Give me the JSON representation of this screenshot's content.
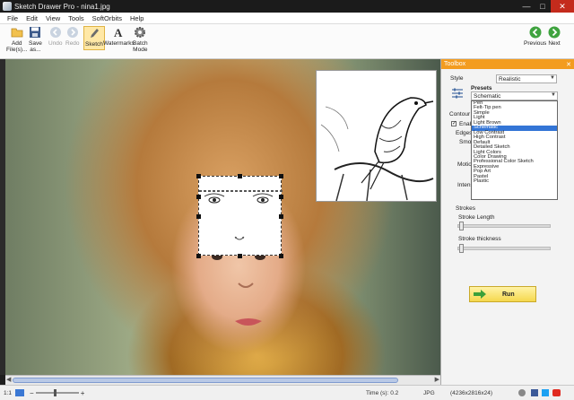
{
  "window": {
    "title": "Sketch Drawer Pro - nina1.jpg"
  },
  "menu": [
    "File",
    "Edit",
    "View",
    "Tools",
    "SoftOrbits",
    "Help"
  ],
  "ribbon": {
    "add_files": "Add\nFile(s)...",
    "save_as": "Save\nas...",
    "undo": "Undo",
    "redo": "Redo",
    "sketch": "Sketch",
    "watermarks": "Watermarks",
    "batch_mode": "Batch\nMode",
    "previous": "Previous",
    "next": "Next"
  },
  "toolbox": {
    "header": "Toolbox",
    "style_label": "Style",
    "style_value": "Realistic",
    "presets_label": "Presets",
    "presets_value": "Schematic",
    "presets": [
      "Pen",
      "Felt-Tip pen",
      "Simple",
      "Light",
      "Light Brown",
      "Schematic",
      "Low Contrast",
      "High Contrast",
      "Default",
      "Detailed Sketch",
      "Light Colors",
      "Color Drawing",
      "Professional Color Sketch",
      "Expressive",
      "Pop Art",
      "Pastel",
      "Plastic"
    ],
    "selected_preset_index": 5,
    "contour_tab": "Contour",
    "enable_label": "Enab",
    "edges_label": "Edges",
    "smooth_label": "Smoo",
    "motion_label": "Motio",
    "intensity_label": "Intens",
    "strokes_label": "Strokes",
    "stroke_length_label": "Stroke Length",
    "stroke_thickness_label": "Stroke thickness",
    "run_label": "Run"
  },
  "status": {
    "zoom": "1:1",
    "time": "Time (s): 0.2",
    "format": "JPG",
    "dimensions": "(4236x2816x24)"
  },
  "colors": {
    "toolbox_header": "#f39c1f",
    "titlebar": "#1b1b1b",
    "close": "#c42b1c",
    "selection": "#3375d6"
  }
}
